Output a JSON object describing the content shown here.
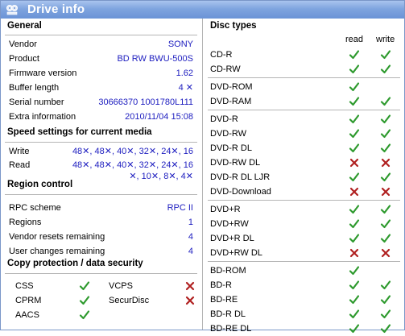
{
  "window": {
    "title": "Drive info",
    "icon": "disc-drive-icon"
  },
  "general": {
    "heading": "General",
    "rows": [
      {
        "label": "Vendor",
        "value": "SONY"
      },
      {
        "label": "Product",
        "value": "BD RW BWU-500S"
      },
      {
        "label": "Firmware version",
        "value": "1.62"
      },
      {
        "label": "Buffer length",
        "value": "4 ✕"
      },
      {
        "label": "Serial number",
        "value": "30666370 1001780L111"
      },
      {
        "label": "Extra information",
        "value": "2010/11/04 15:08"
      }
    ]
  },
  "speed": {
    "heading": "Speed settings for current media",
    "write_label": "Write",
    "write_value": "48✕, 48✕, 40✕, 32✕, 24✕, 16",
    "read_label": "Read",
    "read_value_line1": "48✕, 48✕, 40✕, 32✕, 24✕, 16",
    "read_value_line2": "✕, 10✕, 8✕, 4✕"
  },
  "region": {
    "heading": "Region control",
    "rows": [
      {
        "label": "RPC scheme",
        "value": "RPC II"
      },
      {
        "label": "Regions",
        "value": "1"
      },
      {
        "label": "Vendor resets remaining",
        "value": "4"
      },
      {
        "label": "User changes remaining",
        "value": "4"
      }
    ]
  },
  "copy_protection": {
    "heading": "Copy protection / data security",
    "items": [
      {
        "label": "CSS",
        "supported": true
      },
      {
        "label": "VCPS",
        "supported": false
      },
      {
        "label": "CPRM",
        "supported": true
      },
      {
        "label": "SecurDisc",
        "supported": false
      },
      {
        "label": "AACS",
        "supported": true
      }
    ]
  },
  "disc_types": {
    "heading": "Disc types",
    "col_read": "read",
    "col_write": "write",
    "groups": [
      [
        {
          "label": "CD-R",
          "read": true,
          "write": true
        },
        {
          "label": "CD-RW",
          "read": true,
          "write": true
        }
      ],
      [
        {
          "label": "DVD-ROM",
          "read": true,
          "write": null
        },
        {
          "label": "DVD-RAM",
          "read": true,
          "write": true
        }
      ],
      [
        {
          "label": "DVD-R",
          "read": true,
          "write": true
        },
        {
          "label": "DVD-RW",
          "read": true,
          "write": true
        },
        {
          "label": "DVD-R DL",
          "read": true,
          "write": true
        },
        {
          "label": "DVD-RW DL",
          "read": false,
          "write": false
        },
        {
          "label": "DVD-R DL LJR",
          "read": true,
          "write": true
        },
        {
          "label": "DVD-Download",
          "read": false,
          "write": false
        }
      ],
      [
        {
          "label": "DVD+R",
          "read": true,
          "write": true
        },
        {
          "label": "DVD+RW",
          "read": true,
          "write": true
        },
        {
          "label": "DVD+R DL",
          "read": true,
          "write": true
        },
        {
          "label": "DVD+RW DL",
          "read": false,
          "write": false
        }
      ],
      [
        {
          "label": "BD-ROM",
          "read": true,
          "write": null
        },
        {
          "label": "BD-R",
          "read": true,
          "write": true
        },
        {
          "label": "BD-RE",
          "read": true,
          "write": true
        },
        {
          "label": "BD-R DL",
          "read": true,
          "write": true
        },
        {
          "label": "BD-RE DL",
          "read": true,
          "write": true
        }
      ]
    ]
  },
  "colors": {
    "check": "#2e9a2e",
    "cross": "#b02020",
    "value_text": "#2020c0",
    "title_bar": "#7fa4df"
  }
}
